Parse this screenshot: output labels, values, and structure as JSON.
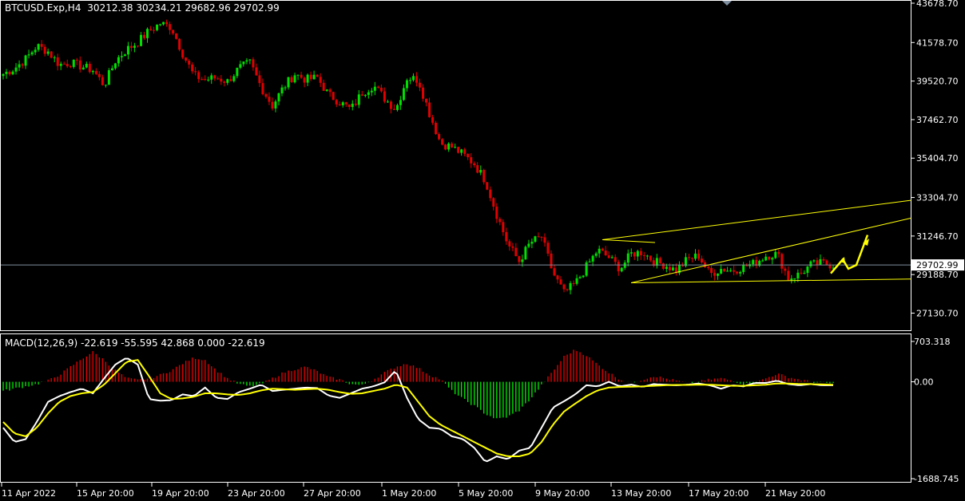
{
  "header": {
    "symbol": "BTCUSD.Exp,H4",
    "ohlc": "30212.38 30234.21 29682.96 29702.99"
  },
  "macd_header": {
    "label": "MACD(12,26,9)",
    "values": "-22.619 -55.595 42.868 0.000 -22.619"
  },
  "current_price_label": "29702.99",
  "colors": {
    "background": "#000000",
    "bull": "#00e000",
    "bear": "#e00000",
    "macd_line": "#ffffff",
    "signal_line": "#ffff00",
    "trendline": "#ffff00",
    "grid_frame": "#ffffff",
    "price_line": "#7f8fa0"
  },
  "chart_data": [
    {
      "type": "candlestick",
      "symbol": "BTCUSD.Exp",
      "timeframe": "H4",
      "y_ticks": [
        "43678.70",
        "41578.70",
        "39520.70",
        "37462.70",
        "35404.70",
        "33304.70",
        "31246.70",
        "29188.70",
        "27130.70"
      ],
      "ylim": [
        26300,
        43678.7
      ],
      "current_price": 29702.99,
      "x_ticks": [
        "11 Apr 2022",
        "15 Apr 20:00",
        "19 Apr 20:00",
        "23 Apr 20:00",
        "27 Apr 20:00",
        "1 May 20:00",
        "5 May 20:00",
        "9 May 20:00",
        "13 May 20:00",
        "17 May 20:00",
        "21 May 20:00"
      ],
      "close_path": [
        39900,
        40200,
        40700,
        41400,
        41100,
        40400,
        40500,
        40300,
        40100,
        39300,
        40600,
        41200,
        41600,
        42200,
        42600,
        42400,
        41000,
        39800,
        39600,
        39700,
        39500,
        40200,
        40500,
        39200,
        38200,
        39200,
        39900,
        39600,
        39700,
        38800,
        38400,
        38000,
        38900,
        39300,
        38600,
        38000,
        39700,
        39600,
        37800,
        36200,
        36000,
        35600,
        35100,
        34200,
        32400,
        30800,
        29900,
        30900,
        31200,
        29300,
        28200,
        28700,
        29600,
        30500,
        30100,
        29500,
        30300,
        30400,
        29900,
        29700,
        29400,
        30000,
        30200,
        29200,
        29500,
        29400,
        29600,
        29800,
        30200,
        30300,
        29000,
        29200,
        29700,
        29800,
        29700
      ],
      "macd_hist_path": [
        -160,
        -120,
        -80,
        -40,
        20,
        120,
        260,
        400,
        520,
        380,
        200,
        60,
        30,
        60,
        120,
        200,
        320,
        420,
        380,
        200,
        60,
        -40,
        -80,
        -40,
        60,
        160,
        220,
        260,
        180,
        80,
        40,
        -40,
        -60,
        40,
        160,
        260,
        320,
        240,
        120,
        40,
        -160,
        -300,
        -420,
        -560,
        -650,
        -610,
        -500,
        -300,
        -60,
        180,
        440,
        560,
        460,
        300,
        160,
        40,
        -20,
        40,
        100,
        60,
        20,
        -20,
        0,
        40,
        60,
        20,
        -40,
        -20,
        60,
        140,
        80,
        40,
        0,
        -20,
        -30
      ],
      "macd_path": [
        -800,
        -1050,
        -1000,
        -700,
        -350,
        -250,
        -180,
        -120,
        -200,
        60,
        300,
        420,
        300,
        -300,
        -330,
        -320,
        -220,
        -250,
        -100,
        -280,
        -300,
        -180,
        -120,
        -50,
        -160,
        -140,
        -120,
        -100,
        -110,
        -240,
        -280,
        -200,
        -120,
        -80,
        -10,
        200,
        -280,
        -650,
        -800,
        -820,
        -950,
        -1000,
        -1150,
        -1400,
        -1300,
        -1350,
        -1200,
        -1150,
        -800,
        -450,
        -340,
        -220,
        -60,
        -80,
        0,
        -80,
        -50,
        -90,
        -40,
        -50,
        -60,
        -50,
        -30,
        -60,
        -120,
        -60,
        -80,
        -20,
        -20,
        20,
        -40,
        -60,
        -40,
        -60,
        -60
      ],
      "signal_path": [
        -700,
        -900,
        -950,
        -800,
        -550,
        -350,
        -250,
        -200,
        -180,
        -50,
        150,
        350,
        380,
        100,
        -200,
        -300,
        -290,
        -260,
        -200,
        -200,
        -220,
        -230,
        -200,
        -150,
        -120,
        -130,
        -140,
        -130,
        -120,
        -140,
        -180,
        -210,
        -200,
        -160,
        -120,
        -50,
        -100,
        -350,
        -600,
        -750,
        -850,
        -950,
        -1050,
        -1150,
        -1250,
        -1300,
        -1300,
        -1250,
        -1050,
        -750,
        -520,
        -380,
        -250,
        -150,
        -100,
        -90,
        -85,
        -80,
        -70,
        -60,
        -55,
        -55,
        -50,
        -50,
        -60,
        -70,
        -70,
        -60,
        -50,
        -30,
        -30,
        -40,
        -40,
        -45,
        -50
      ],
      "macd_ylim": [
        -1688.745,
        703.318
      ],
      "macd_y_ticks": [
        "703.318",
        "0.00",
        "-1688.745"
      ]
    }
  ]
}
